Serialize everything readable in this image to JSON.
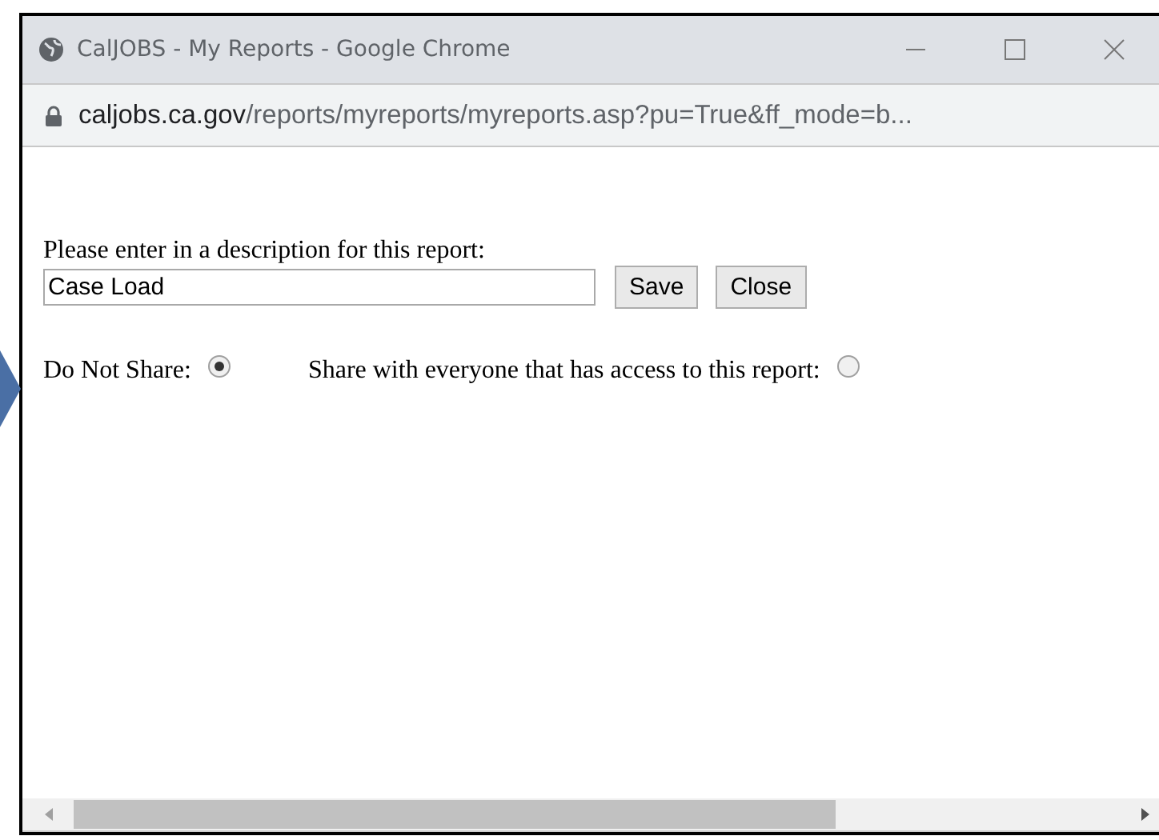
{
  "window": {
    "title": "CalJOBS - My Reports - Google Chrome"
  },
  "address_bar": {
    "host": "caljobs.ca.gov",
    "path": "/reports/myreports/myreports.asp?pu=True&ff_mode=b..."
  },
  "form": {
    "prompt": "Please enter in a description for this report:",
    "description": {
      "value": "Case Load"
    },
    "buttons": [
      {
        "label": "Save"
      },
      {
        "label": "Close"
      }
    ],
    "sharing": [
      {
        "label": "Do Not Share:",
        "selected": true
      },
      {
        "label": "Share with everyone that has access to this report:",
        "selected": false
      }
    ]
  }
}
